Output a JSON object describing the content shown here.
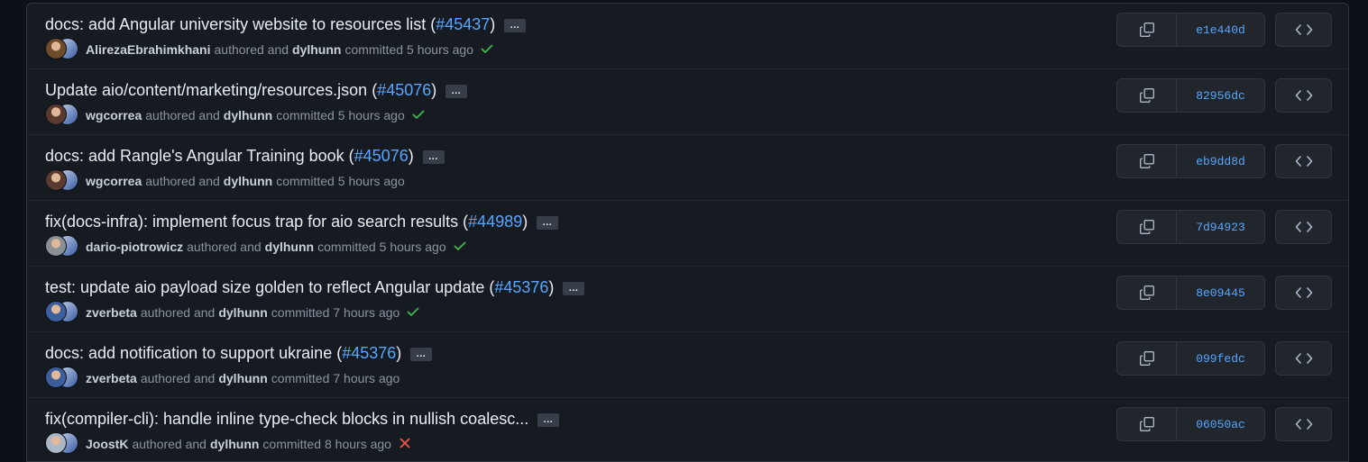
{
  "commits": [
    {
      "title": "docs: add Angular university website to resources list (",
      "pr": "#45437",
      "close": ")",
      "author": "AlirezaEbrahimkhani",
      "authored_text": "authored and",
      "committer": "dylhunn",
      "committed_text": "committed",
      "time": "5 hours ago",
      "status": "success",
      "sha": "e1e440d",
      "avatar_color": "#6e4b2a"
    },
    {
      "title": "Update aio/content/marketing/resources.json (",
      "pr": "#45076",
      "close": ")",
      "author": "wgcorrea",
      "authored_text": "authored and",
      "committer": "dylhunn",
      "committed_text": "committed",
      "time": "5 hours ago",
      "status": "success",
      "sha": "82956dc",
      "avatar_color": "#5a3a2e"
    },
    {
      "title": "docs: add Rangle's Angular Training book (",
      "pr": "#45076",
      "close": ")",
      "author": "wgcorrea",
      "authored_text": "authored and",
      "committer": "dylhunn",
      "committed_text": "committed",
      "time": "5 hours ago",
      "status": "none",
      "sha": "eb9dd8d",
      "avatar_color": "#5a3a2e"
    },
    {
      "title": "fix(docs-infra): implement focus trap for aio search results (",
      "pr": "#44989",
      "close": ")",
      "author": "dario-piotrowicz",
      "authored_text": "authored and",
      "committer": "dylhunn",
      "committed_text": "committed",
      "time": "5 hours ago",
      "status": "success",
      "sha": "7d94923",
      "avatar_color": "#8a8f96"
    },
    {
      "title": "test: update aio payload size golden to reflect Angular update (",
      "pr": "#45376",
      "close": ")",
      "author": "zverbeta",
      "authored_text": "authored and",
      "committer": "dylhunn",
      "committed_text": "committed",
      "time": "7 hours ago",
      "status": "success",
      "sha": "8e09445",
      "avatar_color": "#3d5e9e"
    },
    {
      "title": "docs: add notification to support ukraine (",
      "pr": "#45376",
      "close": ")",
      "author": "zverbeta",
      "authored_text": "authored and",
      "committer": "dylhunn",
      "committed_text": "committed",
      "time": "7 hours ago",
      "status": "none",
      "sha": "099fedc",
      "avatar_color": "#3d5e9e"
    },
    {
      "title": "fix(compiler-cli): handle inline type-check blocks in nullish coalesc...",
      "pr": "",
      "close": "",
      "author": "JoostK",
      "authored_text": "authored and",
      "committer": "dylhunn",
      "committed_text": "committed",
      "time": "8 hours ago",
      "status": "failure",
      "sha": "06050ac",
      "avatar_color": "#a9b7c6"
    }
  ],
  "ellipsis_label": "…",
  "colors": {
    "success": "#3fb950",
    "failure": "#f85149",
    "link": "#58a6ff"
  },
  "icons": {
    "copy": "copy-icon",
    "code": "code-icon",
    "check": "check-icon",
    "x": "x-icon"
  }
}
